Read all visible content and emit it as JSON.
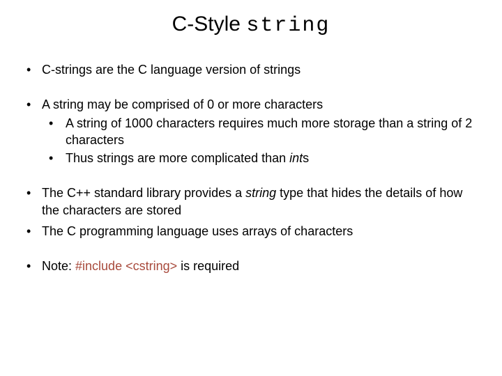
{
  "title": {
    "prefix": "C-Style ",
    "code": "string"
  },
  "b1": "C-strings are the C language version of strings",
  "b2": "A string may be comprised of 0 or more characters",
  "b2a": "A string of 1000 characters requires much more storage than a string of 2 characters",
  "b2b_pre": "Thus strings are more complicated than ",
  "b2b_it": "int",
  "b2b_post": "s",
  "b3_pre": "The C++ standard library provides a ",
  "b3_it": "string",
  "b3_post": " type that hides the details of how the characters are stored",
  "b4": "The C programming language uses arrays of characters",
  "b5_pre": "Note:  ",
  "b5_accent": "#include <cstring>",
  "b5_post": " is required"
}
